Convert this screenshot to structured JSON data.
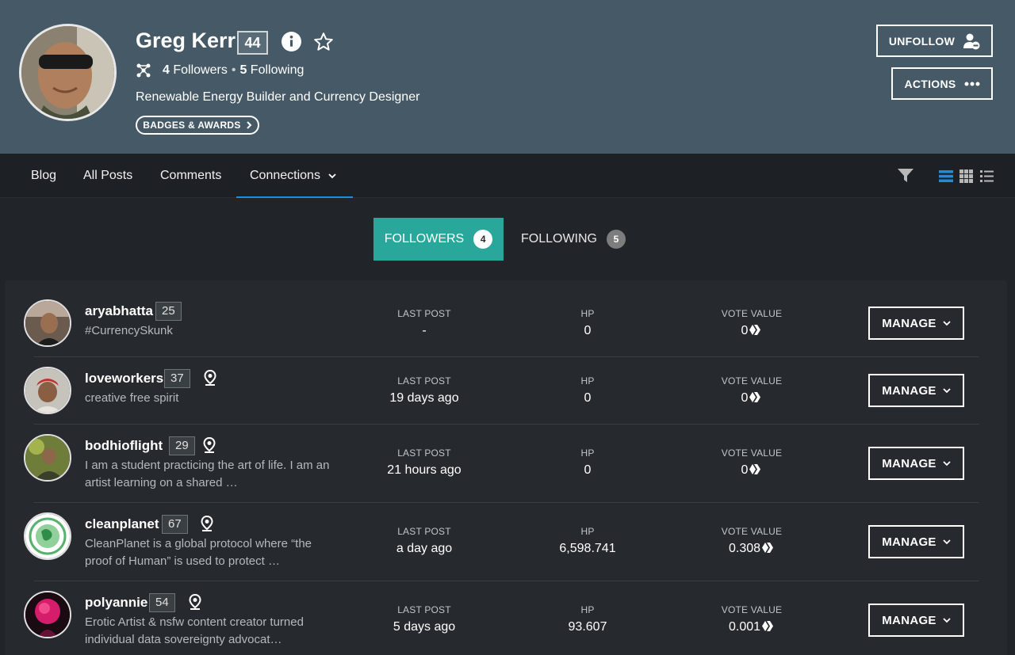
{
  "profile": {
    "name": "Greg Kerr",
    "reputation": "44",
    "followers_count": "4",
    "followers_label": "Followers",
    "following_count": "5",
    "following_label": "Following",
    "separator": "•",
    "about": "Renewable Energy Builder and Currency Designer",
    "badges_label": "BADGES & AWARDS",
    "unfollow_label": "UNFOLLOW",
    "actions_label": "ACTIONS"
  },
  "nav": {
    "items": [
      "Blog",
      "All Posts",
      "Comments",
      "Connections"
    ]
  },
  "tabs": {
    "followers_label": "FOLLOWERS",
    "followers_count": "4",
    "following_label": "FOLLOWING",
    "following_count": "5"
  },
  "columns": {
    "last_post": "LAST POST",
    "hp": "HP",
    "vote_value": "VOTE VALUE"
  },
  "manage_label": "MANAGE",
  "followers": [
    {
      "name": "aryabhatta",
      "rep": "25",
      "desc": "#CurrencySkunk",
      "last_post": "-",
      "hp": "0",
      "vote": "0",
      "pin": false
    },
    {
      "name": "loveworkers",
      "rep": "37",
      "desc": "creative free spirit",
      "last_post": "19 days ago",
      "hp": "0",
      "vote": "0",
      "pin": true
    },
    {
      "name": "bodhioflight",
      "rep": "29",
      "desc": "I am a student practicing the art of life. I am an artist learning on a shared …",
      "last_post": "21 hours ago",
      "hp": "0",
      "vote": "0",
      "pin": true
    },
    {
      "name": "cleanplanet",
      "rep": "67",
      "desc": "CleanPlanet is a global protocol where “the proof of Human” is used to protect …",
      "last_post": "a day ago",
      "hp": "6,598.741",
      "vote": "0.308",
      "pin": true
    },
    {
      "name": "polyannie",
      "rep": "54",
      "desc": "Erotic Artist & nsfw content creator turned individual data sovereignty advocat…",
      "last_post": "5 days ago",
      "hp": "93.607",
      "vote": "0.001",
      "pin": true
    }
  ],
  "colors": {
    "header_bg": "#465966",
    "accent_teal": "#2aa79b",
    "accent_blue": "#1a8fe0",
    "page_bg": "#212529"
  }
}
